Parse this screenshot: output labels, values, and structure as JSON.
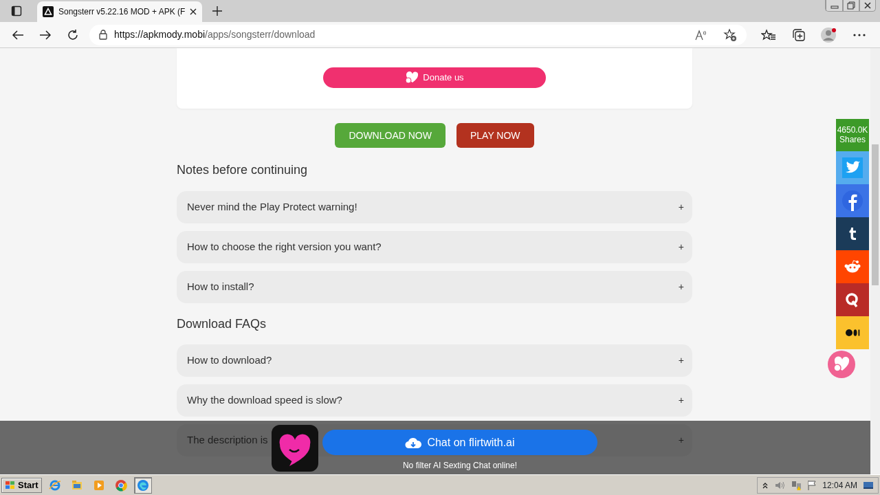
{
  "browser": {
    "tab_title": "Songsterr v5.22.16 MOD + APK (F",
    "url_host": "https://apkmody.mobi",
    "url_path": "/apps/songsterr/download"
  },
  "donate_button": "Donate us",
  "actions": [
    {
      "label": "DOWNLOAD NOW",
      "kind": "download"
    },
    {
      "label": "PLAY NOW",
      "kind": "play"
    }
  ],
  "sections": [
    {
      "title": "Notes before continuing",
      "items": [
        {
          "question": "Never mind the Play Protect warning!",
          "toggle": "+"
        },
        {
          "question": "How to choose the right version you want?",
          "toggle": "+"
        },
        {
          "question": "How to install?",
          "toggle": "+"
        }
      ]
    },
    {
      "title": "Download FAQs",
      "items": [
        {
          "question": "How to download?",
          "toggle": "+"
        },
        {
          "question": "Why the download speed is slow?",
          "toggle": "+"
        },
        {
          "question": "The description is",
          "toggle": "+"
        }
      ]
    }
  ],
  "share_bar": {
    "count": "4650.0K",
    "label": "Shares",
    "networks": [
      {
        "kind": "twitter",
        "color": "#55acee"
      },
      {
        "kind": "facebook",
        "color": "#3b73e6"
      },
      {
        "kind": "tumblr",
        "color": "#1b3b59"
      },
      {
        "kind": "reddit",
        "color": "#ff4500"
      },
      {
        "kind": "quora",
        "color": "#b92b27"
      },
      {
        "kind": "medium",
        "color": "#fbc12d"
      }
    ]
  },
  "ad": {
    "button": "Chat on flirtwith.ai",
    "caption": "No filter AI Sexting Chat online!"
  },
  "taskbar": {
    "start": "Start",
    "apps": [
      {
        "kind": "ie",
        "selected": false
      },
      {
        "kind": "folder",
        "selected": false
      },
      {
        "kind": "media",
        "selected": false
      },
      {
        "kind": "chrome",
        "selected": false
      },
      {
        "kind": "edge",
        "selected": true
      }
    ],
    "clock": "12:04 AM"
  }
}
